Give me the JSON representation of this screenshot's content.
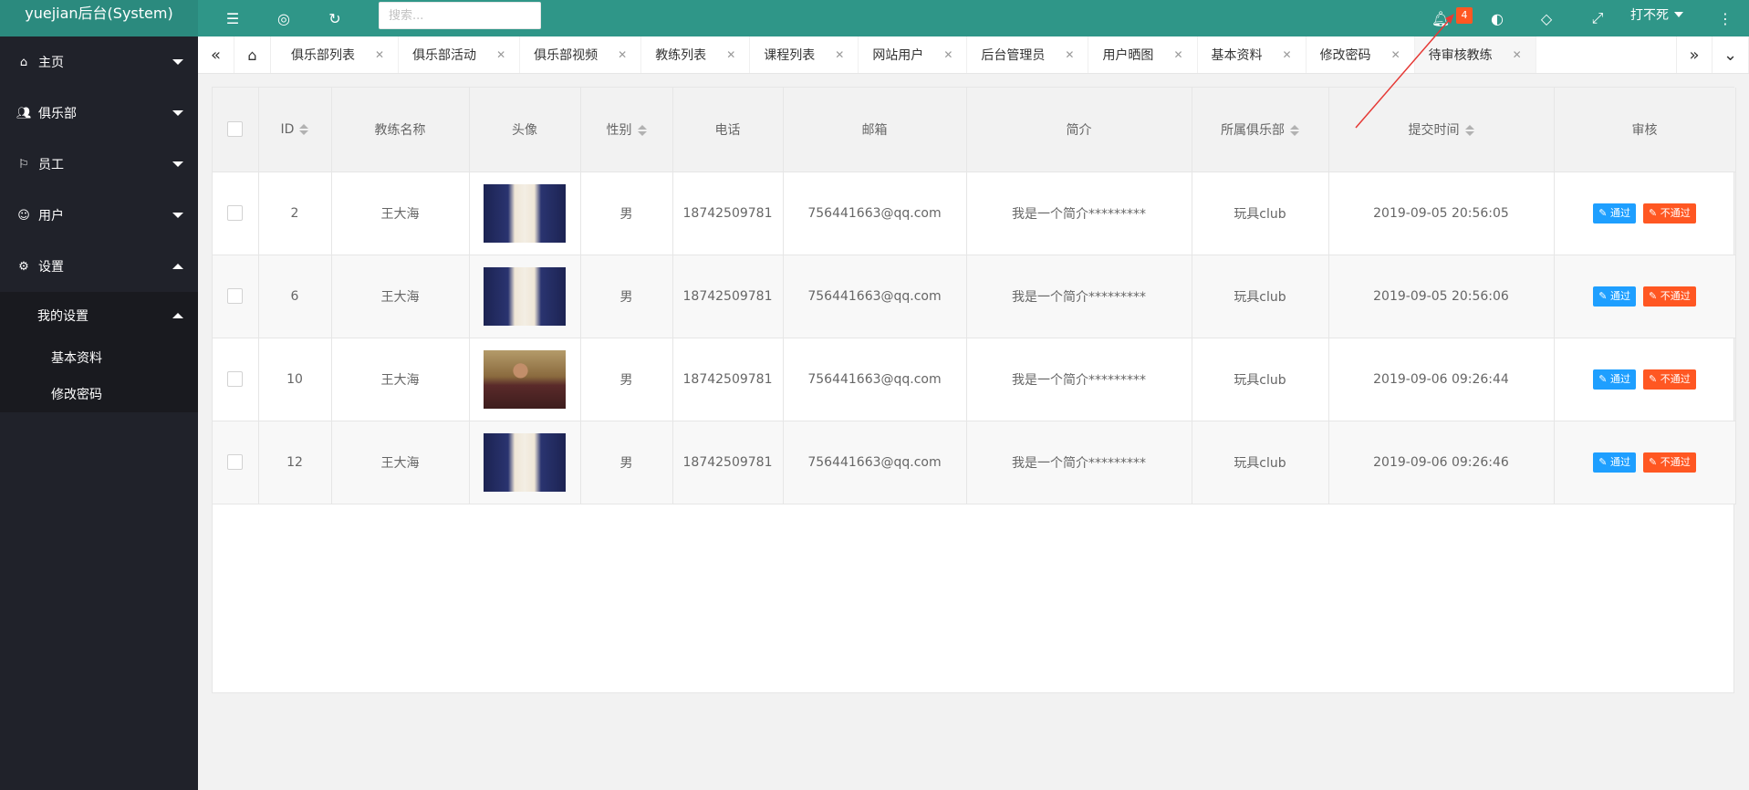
{
  "app": {
    "title": "yuejian后台(System)"
  },
  "header": {
    "search_placeholder": "搜索...",
    "notification_count": "4",
    "user_name": "打不死"
  },
  "sidebar": {
    "items": [
      {
        "label": "主页",
        "icon": "home-icon"
      },
      {
        "label": "俱乐部",
        "icon": "users-icon"
      },
      {
        "label": "员工",
        "icon": "flag-icon"
      },
      {
        "label": "用户",
        "icon": "user-icon"
      },
      {
        "label": "设置",
        "icon": "gear-icon"
      }
    ],
    "submenu": {
      "head": "我的设置",
      "items": [
        "基本资料",
        "修改密码"
      ]
    }
  },
  "tabs": {
    "items": [
      "俱乐部列表",
      "俱乐部活动",
      "俱乐部视频",
      "教练列表",
      "课程列表",
      "网站用户",
      "后台管理员",
      "用户晒图",
      "基本资料",
      "修改密码",
      "待审核教练"
    ],
    "active": "待审核教练"
  },
  "table": {
    "headers": [
      "ID",
      "教练名称",
      "头像",
      "性别",
      "电话",
      "邮箱",
      "简介",
      "所属俱乐部",
      "提交时间",
      "审核"
    ],
    "pass_label": "通过",
    "fail_label": "不通过",
    "rows": [
      {
        "id": "2",
        "name": "王大海",
        "avatar": "suit",
        "gender": "男",
        "phone": "18742509781",
        "email": "756441663@qq.com",
        "intro": "我是一个简介*********",
        "club": "玩具club",
        "time": "2019-09-05 20:56:05"
      },
      {
        "id": "6",
        "name": "王大海",
        "avatar": "suit",
        "gender": "男",
        "phone": "18742509781",
        "email": "756441663@qq.com",
        "intro": "我是一个简介*********",
        "club": "玩具club",
        "time": "2019-09-05 20:56:06"
      },
      {
        "id": "10",
        "name": "王大海",
        "avatar": "man",
        "gender": "男",
        "phone": "18742509781",
        "email": "756441663@qq.com",
        "intro": "我是一个简介*********",
        "club": "玩具club",
        "time": "2019-09-06 09:26:44"
      },
      {
        "id": "12",
        "name": "王大海",
        "avatar": "suit",
        "gender": "男",
        "phone": "18742509781",
        "email": "756441663@qq.com",
        "intro": "我是一个简介*********",
        "club": "玩具club",
        "time": "2019-09-06 09:26:46"
      }
    ]
  },
  "colors": {
    "header": "#2f9688",
    "sidebar": "#20222a",
    "pass": "#1e9fff",
    "fail": "#ff5722",
    "annotation": "#e53935"
  }
}
